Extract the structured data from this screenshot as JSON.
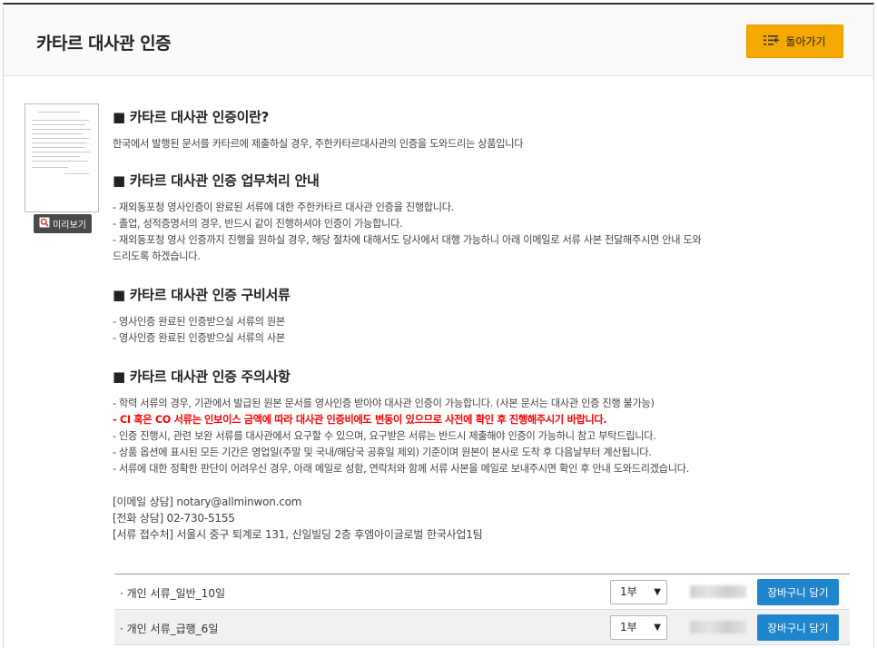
{
  "header": {
    "title": "카타르 대사관 인증",
    "back_label": "돌아가기"
  },
  "preview": {
    "label": "미리보기"
  },
  "sections": [
    {
      "title": "■ 카타르 대사관 인증이란?",
      "lines": [
        "한국에서 발행된 문서를 카타르에 제출하실 경우, 주한카타르대사관의 인증을 도와드리는 상품입니다"
      ]
    },
    {
      "title": "■ 카타르 대사관 인증 업무처리 안내",
      "lines": [
        "- 재외동포청 영사인증이 완료된 서류에 대한 주한카타르 대사관 인증을 진행합니다.",
        "- 졸업, 성적증명서의 경우, 반드시 같이 진행하셔야 인증이 가능합니다.",
        "- 재외동포청 영사 인증까지 진행을 원하실 경우, 해당 절차에 대해서도 당사에서 대행 가능하니 아래 이메일로 서류 사본 전달해주시면 안내 도와",
        "드리도록 하겠습니다."
      ]
    },
    {
      "title": "■ 카타르 대사관 인증 구비서류",
      "lines": [
        "- 영사인증 완료된 인증받으실 서류의 원본",
        "- 영사인증 완료된 인증받으실 서류의 사본"
      ]
    },
    {
      "title": "■ 카타르 대사관 인증 주의사항",
      "lines": [
        "- 학력 서류의 경우, 기관에서 발급된 원본 문서를 영사인증 받아야 대사관 인증이 가능합니다. (사본 문서는 대사관 인증 진행 불가능)",
        "- CI 혹은 CO 서류는 인보이스 금액에 따라 대사관 인증비에도 변동이 있으므로 사전에 확인 후 진행해주시기 바랍니다.",
        "- 인증 진행시, 관련 보완 서류를 대사관에서 요구할 수 있으며, 요구받은 서류는 반드시 제출해야 인증이 가능하니 참고 부탁드립니다.",
        "- 상품 옵션에 표시된 모든 기간은 영업일(주말 및 국내/해당국 공휴일 제외) 기준이며 원본이 본사로 도착 후 다음날부터 계산됩니다.",
        "- 서류에 대한 정확한 판단이 어려우신 경우, 아래 메일로 성함, 연락처와 함께 서류 사본을 메일로 보내주시면 확인 후 안내 도와드리겠습니다."
      ]
    }
  ],
  "contact": {
    "email": "[이메일 상담] notary@allminwon.com",
    "phone": "[전화 상담] 02-730-5155",
    "address": "[서류 접수처] 서울시 중구 퇴계로 131, 신일빌딩 2층 후엠아이글로벌 한국사업1팀"
  },
  "products": [
    {
      "name": "· 개인 서류_일반_10일",
      "qty": "1부",
      "cart_label": "장바구니 담기"
    },
    {
      "name": "· 개인 서류_급행_6일",
      "qty": "1부",
      "cart_label": "장바구니 담기"
    }
  ],
  "colors": {
    "accent": "#f5a800",
    "cart": "#1f86cd",
    "warning": "#ff0000"
  }
}
